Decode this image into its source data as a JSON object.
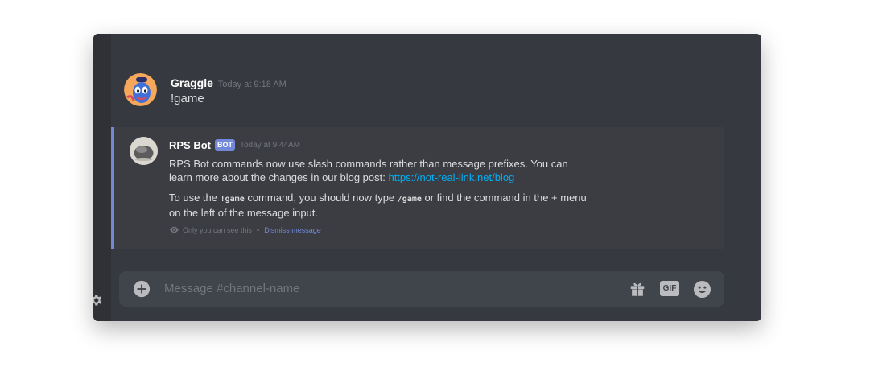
{
  "message": {
    "username": "Graggle",
    "timestamp": "Today at 9:18 AM",
    "content": "!game"
  },
  "ephemeral": {
    "bot_name": "RPS Bot",
    "bot_tag": "BOT",
    "timestamp": "Today at 9:44AM",
    "para1_text": "RPS Bot commands now use slash commands rather than message prefixes. You can learn more about the changes in our blog post: ",
    "para1_link": "https://not-real-link.net/blog",
    "para2_a": "To use the ",
    "para2_code1": "!game",
    "para2_b": " command, you should now type ",
    "para2_code2": "/game",
    "para2_c": " or find the command in the + menu on the left of the message input.",
    "visibility_note": "Only you can see this",
    "separator": "•",
    "dismiss_label": "Dismiss message"
  },
  "input": {
    "placeholder": "Message #channel-name",
    "gif_label": "GIF"
  },
  "icons": {
    "settings": "gear-icon",
    "add": "plus-circle-icon",
    "gift": "gift-icon",
    "gif": "gif-icon",
    "emoji": "smiley-icon",
    "visibility": "eye-icon"
  },
  "colors": {
    "background": "#36393f",
    "accent": "#7289da",
    "link": "#00b0f4",
    "ephemeral_bg": "#3b3d43"
  }
}
